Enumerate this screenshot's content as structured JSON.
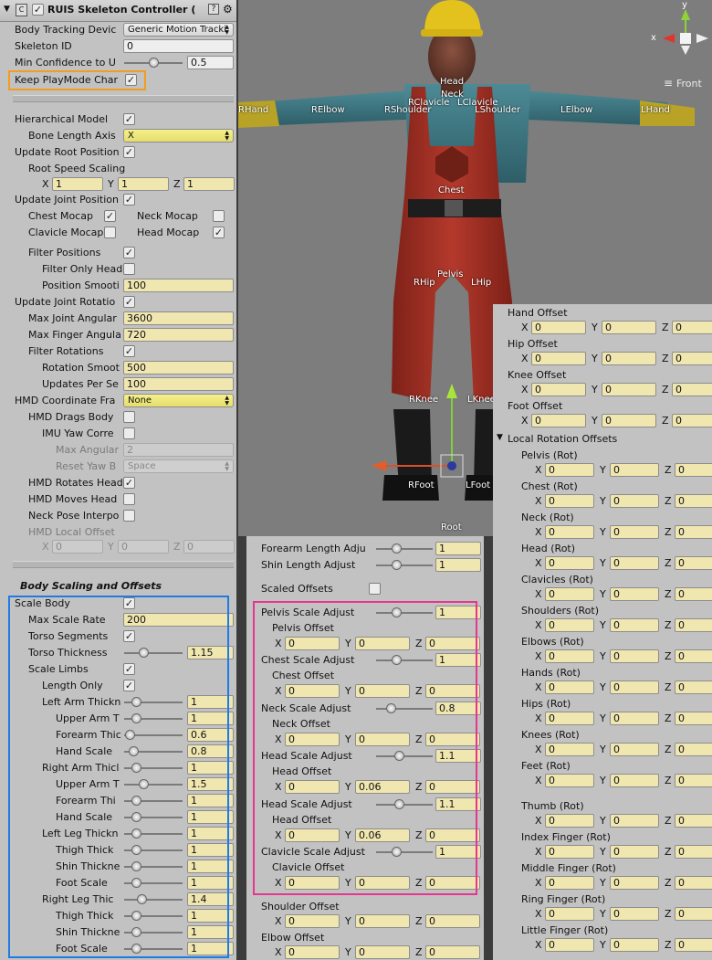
{
  "inspector": {
    "title": "RUIS Skeleton Controller (",
    "body_tracking_label": "Body Tracking Devic",
    "body_tracking_value": "Generic Motion Tracki",
    "skeleton_id_label": "Skeleton ID",
    "skeleton_id_value": "0",
    "min_conf_label": "Min Confidence to U",
    "min_conf_value": "0.5",
    "keep_playmode_label": "Keep PlayMode Char",
    "hier_label": "Hierarchical Model",
    "bone_axis_label": "Bone Length Axis",
    "bone_axis_value": "X",
    "update_root_label": "Update Root Position",
    "root_speed_label": "Root Speed Scaling",
    "root_x": "1",
    "root_y": "1",
    "root_z": "1",
    "update_joint_label": "Update Joint Position",
    "chest_mocap_label": "Chest Mocap",
    "neck_mocap_label": "Neck Mocap",
    "clavicle_mocap_label": "Clavicle Mocap",
    "head_mocap_label": "Head Mocap",
    "filter_pos_label": "Filter Positions",
    "filter_head_label": "Filter Only Head",
    "pos_smooth_label": "Position Smooti",
    "pos_smooth_value": "100",
    "update_rot_label": "Update Joint Rotatio",
    "max_joint_label": "Max Joint Angular",
    "max_joint_value": "3600",
    "max_finger_label": "Max Finger Angula",
    "max_finger_value": "720",
    "filter_rot_label": "Filter Rotations",
    "rot_smooth_label": "Rotation Smoot",
    "rot_smooth_value": "500",
    "updates_label": "Updates Per Se",
    "updates_value": "100",
    "hmd_coord_label": "HMD Coordinate Fra",
    "hmd_coord_value": "None",
    "hmd_drags_label": "HMD Drags Body",
    "imu_label": "IMU Yaw Corre",
    "max_angular_label": "Max Angular",
    "max_angular_value": "2",
    "reset_yaw_label": "Reset Yaw B",
    "reset_yaw_value": "Space",
    "hmd_rotates_label": "HMD Rotates Head",
    "hmd_moves_label": "HMD Moves Head",
    "neck_interp_label": "Neck Pose Interpo",
    "hmd_local_label": "HMD Local Offset",
    "hmd_x": "0",
    "hmd_y": "0",
    "hmd_z": "0",
    "body_scaling_header": "Body Scaling and Offsets",
    "scale_body_label": "Scale Body",
    "max_scale_label": "Max Scale Rate",
    "max_scale_value": "200",
    "torso_seg_label": "Torso Segments",
    "torso_thick_label": "Torso Thickness",
    "torso_thick_value": "1.15",
    "torso_thick_frac": 0.33,
    "scale_limbs_label": "Scale Limbs",
    "length_only_label": "Length Only",
    "limbs": [
      {
        "label": "Left Arm Thickn",
        "value": "1",
        "frac": 0.2,
        "indent": 0
      },
      {
        "label": "Upper Arm T",
        "value": "1",
        "frac": 0.2,
        "indent": 1
      },
      {
        "label": "Forearm Thic",
        "value": "0.6",
        "frac": 0.1,
        "indent": 1
      },
      {
        "label": "Hand Scale",
        "value": "0.8",
        "frac": 0.15,
        "indent": 1
      },
      {
        "label": "Right Arm Thicl",
        "value": "1",
        "frac": 0.2,
        "indent": 0
      },
      {
        "label": "Upper Arm T",
        "value": "1.5",
        "frac": 0.33,
        "indent": 1
      },
      {
        "label": "Forearm Thi",
        "value": "1",
        "frac": 0.2,
        "indent": 1
      },
      {
        "label": "Hand Scale",
        "value": "1",
        "frac": 0.2,
        "indent": 1
      },
      {
        "label": "Left Leg Thickn",
        "value": "1",
        "frac": 0.2,
        "indent": 0
      },
      {
        "label": "Thigh Thick",
        "value": "1",
        "frac": 0.2,
        "indent": 1
      },
      {
        "label": "Shin Thickne",
        "value": "1",
        "frac": 0.2,
        "indent": 1
      },
      {
        "label": "Foot Scale",
        "value": "1",
        "frac": 0.2,
        "indent": 1
      },
      {
        "label": "Right Leg Thic",
        "value": "1.4",
        "frac": 0.3,
        "indent": 0
      },
      {
        "label": "Thigh Thick",
        "value": "1",
        "frac": 0.2,
        "indent": 1
      },
      {
        "label": "Shin Thickne",
        "value": "1",
        "frac": 0.2,
        "indent": 1
      },
      {
        "label": "Foot Scale",
        "value": "1",
        "frac": 0.2,
        "indent": 1
      }
    ]
  },
  "middle": {
    "forearm_adj_label": "Forearm Length Adju",
    "forearm_adj_value": "1",
    "forearm_adj_frac": 0.35,
    "shin_adj_label": "Shin Length Adjust",
    "shin_adj_value": "1",
    "shin_adj_frac": 0.35,
    "scaled_offsets_label": "Scaled Offsets",
    "blocks": [
      {
        "adj": "Pelvis Scale Adjust",
        "adj_value": "1",
        "frac": 0.35,
        "offset": "Pelvis Offset",
        "x": "0",
        "y": "0",
        "z": "0"
      },
      {
        "adj": "Chest Scale Adjust",
        "adj_value": "1",
        "frac": 0.35,
        "offset": "Chest Offset",
        "x": "0",
        "y": "0",
        "z": "0"
      },
      {
        "adj": "Neck Scale Adjust",
        "adj_value": "0.8",
        "frac": 0.25,
        "offset": "Neck Offset",
        "x": "0",
        "y": "0",
        "z": "0"
      },
      {
        "adj": "Head Scale Adjust",
        "adj_value": "1.1",
        "frac": 0.4,
        "offset": "Head Offset",
        "x": "0",
        "y": "0.06",
        "z": "0"
      },
      {
        "adj": "Head Scale Adjust",
        "adj_value": "1.1",
        "frac": 0.4,
        "offset": "Head Offset",
        "x": "0",
        "y": "0.06",
        "z": "0"
      },
      {
        "adj": "Clavicle Scale Adjust",
        "adj_value": "1",
        "frac": 0.35,
        "offset": "Clavicle Offset",
        "x": "0",
        "y": "0",
        "z": "0"
      }
    ],
    "shoulder_label": "Shoulder Offset",
    "shoulder_x": "0",
    "shoulder_y": "0",
    "shoulder_z": "0",
    "elbow_label": "Elbow Offset",
    "elbow_x": "0",
    "elbow_y": "0",
    "elbow_z": "0"
  },
  "right": {
    "offsets": [
      {
        "label": "Hand Offset",
        "x": "0",
        "y": "0",
        "z": "0"
      },
      {
        "label": "Hip Offset",
        "x": "0",
        "y": "0",
        "z": "0"
      },
      {
        "label": "Knee Offset",
        "x": "0",
        "y": "0",
        "z": "0"
      },
      {
        "label": "Foot Offset",
        "x": "0",
        "y": "0",
        "z": "0"
      }
    ],
    "local_rot_header": "Local Rotation Offsets",
    "rots": [
      {
        "label": "Pelvis (Rot)",
        "x": "0",
        "y": "0",
        "z": "0"
      },
      {
        "label": "Chest (Rot)",
        "x": "0",
        "y": "0",
        "z": "0"
      },
      {
        "label": "Neck (Rot)",
        "x": "0",
        "y": "0",
        "z": "0"
      },
      {
        "label": "Head (Rot)",
        "x": "0",
        "y": "0",
        "z": "0"
      },
      {
        "label": "Clavicles (Rot)",
        "x": "0",
        "y": "0",
        "z": "0"
      },
      {
        "label": "Shoulders (Rot)",
        "x": "0",
        "y": "0",
        "z": "0"
      },
      {
        "label": "Elbows (Rot)",
        "x": "0",
        "y": "0",
        "z": "0"
      },
      {
        "label": "Hands (Rot)",
        "x": "0",
        "y": "0",
        "z": "0"
      },
      {
        "label": "Hips (Rot)",
        "x": "0",
        "y": "0",
        "z": "0"
      },
      {
        "label": "Knees (Rot)",
        "x": "0",
        "y": "0",
        "z": "0"
      },
      {
        "label": "Feet (Rot)",
        "x": "0",
        "y": "0",
        "z": "0"
      }
    ],
    "fingers": [
      {
        "label": "Thumb (Rot)",
        "x": "0",
        "y": "0",
        "z": "0"
      },
      {
        "label": "Index Finger (Rot)",
        "x": "0",
        "y": "0",
        "z": "0"
      },
      {
        "label": "Middle Finger (Rot)",
        "x": "0",
        "y": "0",
        "z": "0"
      },
      {
        "label": "Ring Finger (Rot)",
        "x": "0",
        "y": "0",
        "z": "0"
      },
      {
        "label": "Little Finger (Rot)",
        "x": "0",
        "y": "0",
        "z": "0"
      }
    ]
  },
  "viewport": {
    "gizmo_front": "Front",
    "axis_x": "x",
    "axis_y": "y",
    "bones": {
      "head": "Head",
      "neck": "Neck",
      "rclav": "RClavicle",
      "lclav": "LClavicle",
      "rhand": "RHand",
      "relbow": "RElbow",
      "rshoulder": "RShoulder",
      "lshoulder": "LShoulder",
      "lelbow": "LElbow",
      "lhand": "LHand",
      "chest": "Chest",
      "pelvis": "Pelvis",
      "rhip": "RHip",
      "lhip": "LHip",
      "rknee": "RKnee",
      "lknee": "LKnee",
      "rfoot": "RFoot",
      "lfoot": "LFoot",
      "root": "Root"
    }
  },
  "colors": {
    "orange": "#f39c1f",
    "blue": "#1e7be5",
    "pink": "#e8358f"
  }
}
